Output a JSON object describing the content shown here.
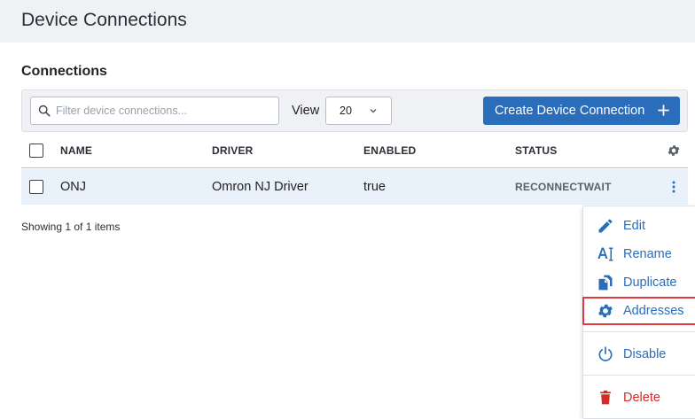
{
  "page": {
    "title": "Device Connections"
  },
  "section": {
    "title": "Connections"
  },
  "toolbar": {
    "search_placeholder": "Filter device connections...",
    "view_label": "View",
    "view_value": "20",
    "create_label": "Create Device Connection"
  },
  "table": {
    "columns": [
      "NAME",
      "DRIVER",
      "ENABLED",
      "STATUS"
    ],
    "rows": [
      {
        "name": "ONJ",
        "driver": "Omron NJ Driver",
        "enabled": "true",
        "status": "RECONNECTWAIT"
      }
    ]
  },
  "footer": {
    "showing": "Showing 1 of 1 items"
  },
  "menu": {
    "items": [
      {
        "label": "Edit",
        "icon": "pencil-icon"
      },
      {
        "label": "Rename",
        "icon": "rename-icon"
      },
      {
        "label": "Duplicate",
        "icon": "duplicate-icon"
      },
      {
        "label": "Addresses",
        "icon": "gear-icon",
        "highlighted": true
      },
      {
        "label": "Disable",
        "icon": "power-icon"
      },
      {
        "label": "Delete",
        "icon": "trash-icon"
      }
    ]
  },
  "colors": {
    "primary": "#2a6ebb",
    "danger": "#d12c2c",
    "highlight_border": "#e0393e",
    "row_selected": "#e9f2fa",
    "header_bg": "#f0f1f4"
  }
}
